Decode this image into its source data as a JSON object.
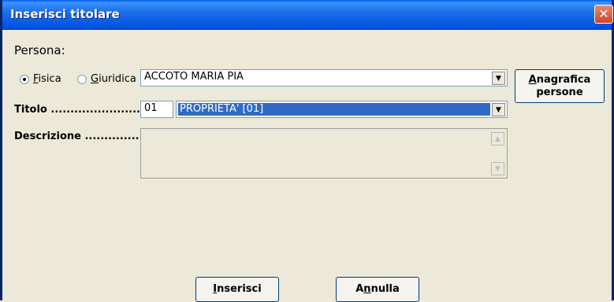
{
  "window": {
    "title": "Inserisci titolare",
    "close_glyph": "✕"
  },
  "persona": {
    "section_label": "Persona:",
    "radio_fisica": {
      "label": "Fisica",
      "selected": true
    },
    "radio_giuridica": {
      "label": "Giuridica",
      "selected": false
    },
    "selected_value": "ACCOTO MARIA PIA"
  },
  "titolo": {
    "label": "Titolo ...........................",
    "code": "01",
    "selected_value": "PROPRIETA' [01]"
  },
  "descrizione": {
    "label": "Descrizione ..............",
    "value": ""
  },
  "buttons": {
    "anagrafica_line1": "Anagrafica",
    "anagrafica_line2": "persone",
    "inserisci": "Inserisci",
    "annulla_pre": "A",
    "annulla_ul": "n",
    "annulla_post": "nulla"
  },
  "icons": {
    "dropdown": "▼",
    "scroll_up": "▲",
    "scroll_down": "▼"
  },
  "colors": {
    "selection": "#316AC5",
    "titlebar": "#0055E5",
    "close": "#D0432A"
  }
}
